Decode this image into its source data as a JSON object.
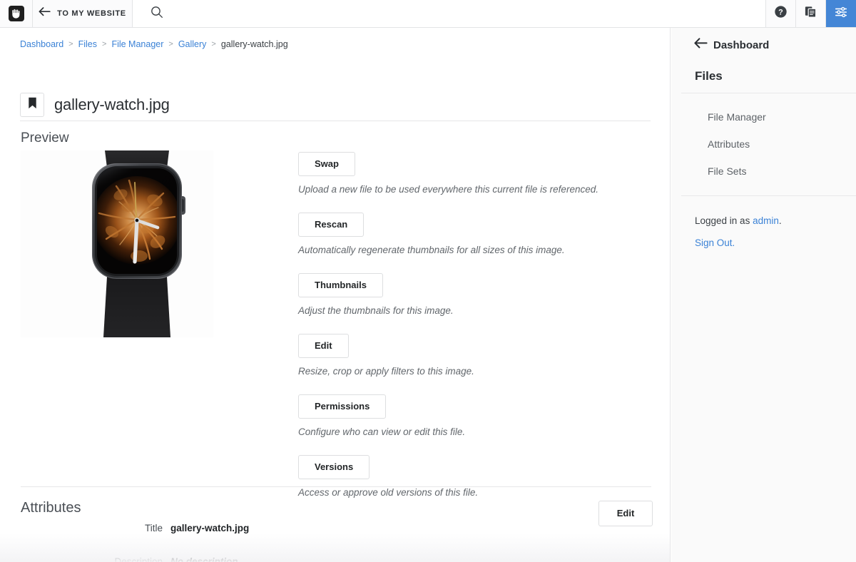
{
  "topbar": {
    "logo_name": "concrete-cms-hand-logo",
    "to_site_label": "TO MY WEBSITE",
    "search_placeholder": "",
    "search_value": "",
    "help_icon": "question-circle-icon",
    "pages_icon": "copy-pages-icon",
    "settings_icon": "sliders-icon",
    "accent_color": "#4486d6"
  },
  "breadcrumb": {
    "items": [
      {
        "label": "Dashboard",
        "link": true
      },
      {
        "label": "Files",
        "link": true
      },
      {
        "label": "File Manager",
        "link": true
      },
      {
        "label": "Gallery",
        "link": true
      },
      {
        "label": "gallery-watch.jpg",
        "link": false
      }
    ],
    "separator": ">"
  },
  "page": {
    "title": "gallery-watch.jpg",
    "bookmark_icon": "bookmark-icon",
    "preview_heading": "Preview",
    "preview_image_alt": "smartwatch-with-flame-watch-face"
  },
  "actions": [
    {
      "label": "Swap",
      "description": "Upload a new file to be used everywhere this current file is referenced."
    },
    {
      "label": "Rescan",
      "description": "Automatically regenerate thumbnails for all sizes of this image."
    },
    {
      "label": "Thumbnails",
      "description": "Adjust the thumbnails for this image."
    },
    {
      "label": "Edit",
      "description": "Resize, crop or apply filters to this image."
    },
    {
      "label": "Permissions",
      "description": "Configure who can view or edit this file."
    },
    {
      "label": "Versions",
      "description": "Access or approve old versions of this file."
    }
  ],
  "attributes": {
    "heading": "Attributes",
    "edit_label": "Edit",
    "rows": [
      {
        "label": "Title",
        "value": "gallery-watch.jpg",
        "empty": false
      },
      {
        "label": "Description",
        "value": "No description",
        "empty": true
      }
    ]
  },
  "sidebar": {
    "back_label": "Dashboard",
    "back_icon": "arrow-left-icon",
    "section_title": "Files",
    "items": [
      {
        "label": "File Manager"
      },
      {
        "label": "Attributes"
      },
      {
        "label": "File Sets"
      }
    ],
    "logged_in_prefix": "Logged in as ",
    "logged_in_user": "admin",
    "logged_in_suffix": ".",
    "sign_out_label": "Sign Out."
  }
}
